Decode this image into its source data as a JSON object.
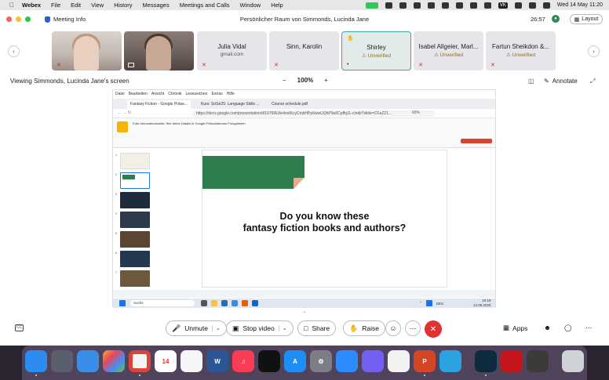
{
  "menubar": {
    "app": "Webex",
    "items": [
      "File",
      "Edit",
      "View",
      "History",
      "Messages",
      "Meetings and Calls",
      "Window",
      "Help"
    ],
    "vk_label": "VK",
    "datetime": "Wed 14 May  11:20"
  },
  "window": {
    "meeting_info": "Meeting Info",
    "title": "Persönlicher Raum von Simmonds, Lucinda Jane",
    "timer": "26:57",
    "layout_label": "Layout"
  },
  "participants": [
    {
      "name": "",
      "type": "video"
    },
    {
      "name": "",
      "type": "video"
    },
    {
      "name": "Julia Vidal",
      "sub": "gmail.com"
    },
    {
      "name": "Sinn, Karolin",
      "sub": ""
    },
    {
      "name": "Shirley",
      "sub": "Unverified"
    },
    {
      "name": "Isabel Allgeier, Marl...",
      "sub": "Unverified"
    },
    {
      "name": "Fartun Sheikdon &...",
      "sub": "Unverified"
    }
  ],
  "viewbar": {
    "viewing": "Viewing Simmonds, Lucinda Jane's screen",
    "zoom": "100%",
    "annotate": "Annotate"
  },
  "shared": {
    "menu": [
      "Datei",
      "Bearbeiten",
      "Ansicht",
      "Chronik",
      "Lesezeichen",
      "Extras",
      "Hilfe"
    ],
    "tabs": [
      "Fantasy Fiction - Google Präse...",
      "Kurs: SoSe25: Language Skills ...",
      "Course schedule.pdf"
    ],
    "url": "https://docs.google.com/presentation/d/1979IA1fe4oolKcyCmbHPp6wwUQhP9u6Cpffq11-c/edit?slide=CFaZ21...",
    "url_zoom": "60%",
    "doc_title": "Folie Informationsseite: Hier deine Details in Google Präsentationen Fotogalerien",
    "slide_line1": "Do you know these",
    "slide_line2": "fantasy fiction books and authors?",
    "taskbar_search": "Suche",
    "lang": "DEU",
    "clock_time": "10:19",
    "clock_date": "14.05.2025",
    "thumb_nums": [
      "1",
      "2",
      "3",
      "4",
      "5",
      "6",
      "7"
    ]
  },
  "controls": {
    "unmute": "Unmute",
    "stop_video": "Stop video",
    "share": "Share",
    "raise": "Raise",
    "apps": "Apps"
  },
  "colors": {
    "accent_teal": "#3aa89a",
    "leave_red": "#e0322e",
    "slide_green": "#2e7d4f"
  }
}
